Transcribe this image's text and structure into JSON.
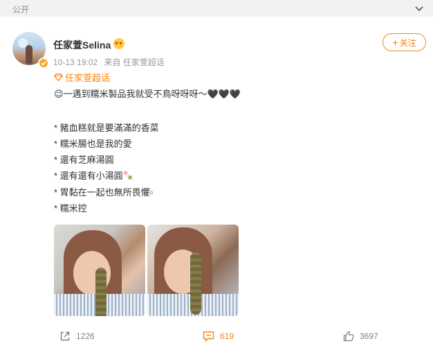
{
  "top": {
    "visibility": "公开"
  },
  "post": {
    "username": "任家萱Selina",
    "date": "10-13 19:02",
    "source": "来自 任家萱超话",
    "follow_label": "关注",
    "supertopic": "任家萱超话",
    "content_lines": [
      "😉一遇到糯米製品我就受不鳥呀呀呀～🖤🖤🖤",
      "",
      "* 豬血糕就是要滿滿的香菜",
      "* 糯米腸也是我的愛",
      "* 還有芝麻湯圓",
      "* 還有還有小湯圓🍡",
      "* 胃黏在一起也無所畏懼▫",
      "* 糯米控"
    ]
  },
  "actions": {
    "repost_count": "1226",
    "comment_count": "619",
    "like_count": "3697"
  },
  "colors": {
    "accent": "#ff8200",
    "text": "#333333",
    "muted": "#999999"
  }
}
